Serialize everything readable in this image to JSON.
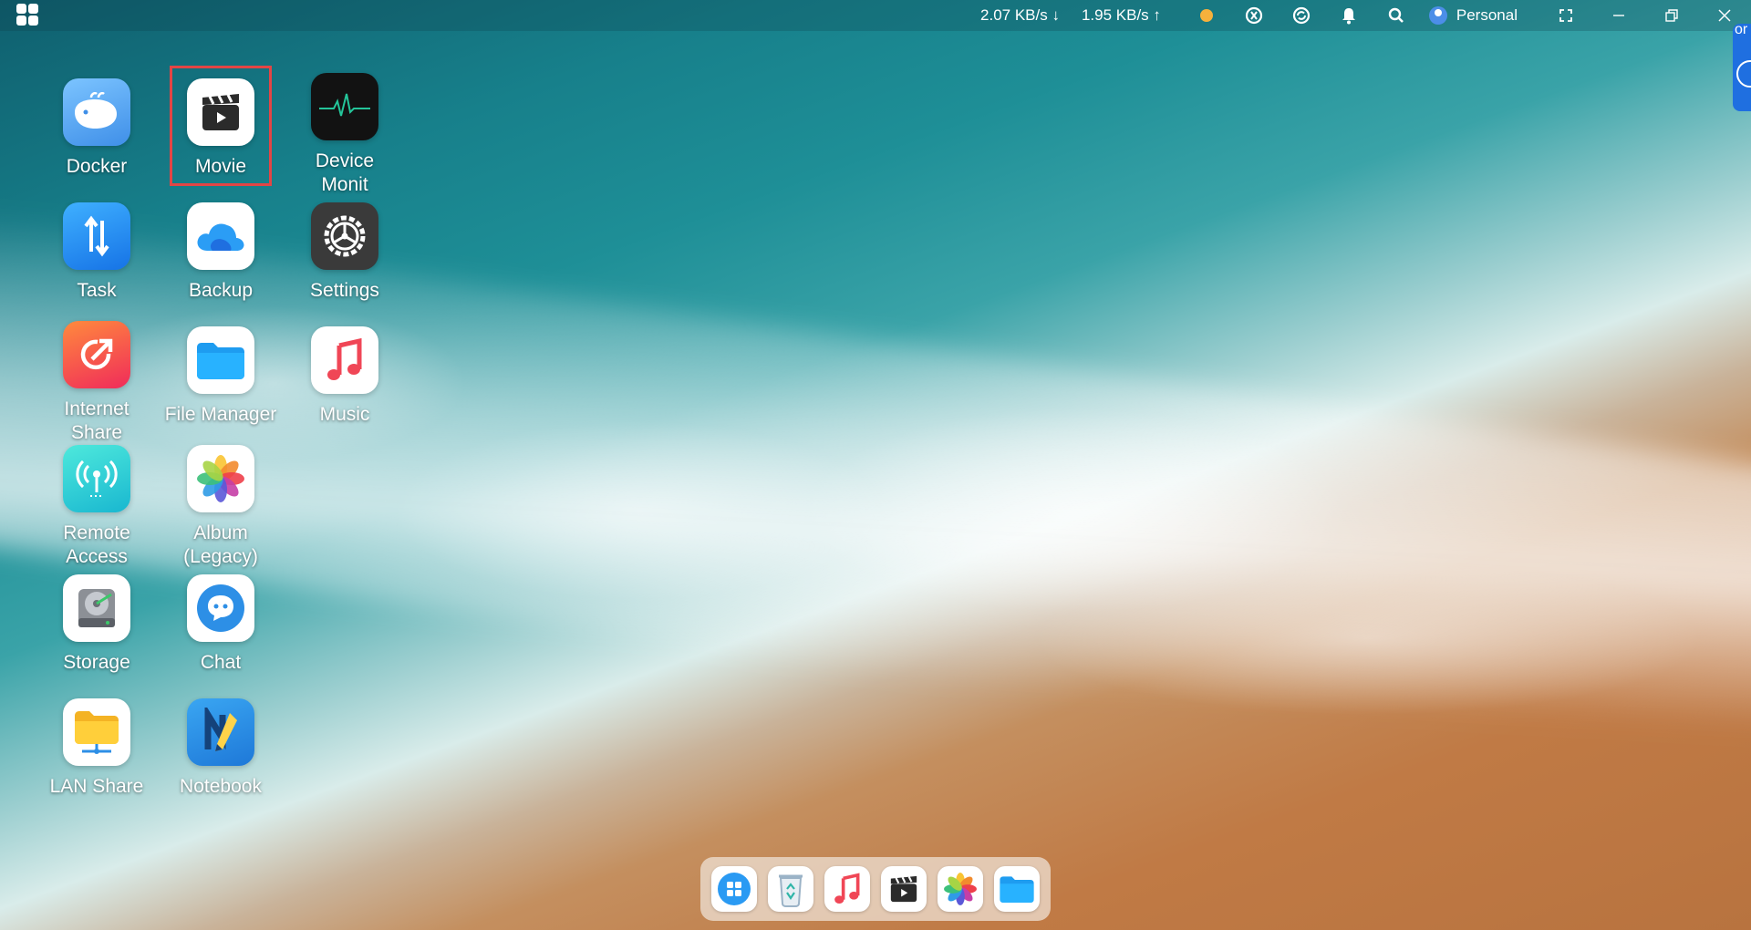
{
  "topbar": {
    "download_speed": "2.07 KB/s ↓",
    "upload_speed": "1.95 KB/s ↑",
    "user_label": "Personal"
  },
  "edge_widget": {
    "text": "or"
  },
  "apps": [
    {
      "label": "Docker",
      "icon": "whale-icon",
      "color": "#4aa3f0"
    },
    {
      "label": "Movie",
      "icon": "clapperboard-icon",
      "color": "#ffffff"
    },
    {
      "label": "Device\nMonit",
      "icon": "heartbeat-monitor-icon",
      "color": "#111111"
    },
    {
      "label": "Task",
      "icon": "transfer-arrows-icon",
      "color": "#1f8ff0"
    },
    {
      "label": "Backup",
      "icon": "cloud-icon",
      "color": "#ffffff"
    },
    {
      "label": "Settings",
      "icon": "gear-icon",
      "color": "#3b3b3b"
    },
    {
      "label": "Internet\nShare",
      "icon": "share-arrow-icon",
      "color": "#f04a3e"
    },
    {
      "label": "File Manager",
      "icon": "folder-icon",
      "color": "#ffffff"
    },
    {
      "label": "Music",
      "icon": "music-note-icon",
      "color": "#ffffff"
    },
    {
      "label": "Remote\nAccess",
      "icon": "antenna-icon",
      "color": "#2fd3d0"
    },
    {
      "label": "Album\n(Legacy)",
      "icon": "photos-flower-icon",
      "color": "#ffffff"
    },
    {
      "label": "Storage",
      "icon": "hard-drive-icon",
      "color": "#ffffff"
    },
    {
      "label": "Chat",
      "icon": "chat-bubble-icon",
      "color": "#ffffff"
    },
    {
      "label": "LAN Share",
      "icon": "lan-folder-icon",
      "color": "#ffffff"
    },
    {
      "label": "Notebook",
      "icon": "notebook-icon",
      "color": "#2d8fe6"
    }
  ],
  "dock": [
    {
      "name": "app-launcher-icon"
    },
    {
      "name": "recycle-bin-icon"
    },
    {
      "name": "music-note-icon"
    },
    {
      "name": "clapperboard-icon"
    },
    {
      "name": "photos-flower-icon"
    },
    {
      "name": "folder-icon"
    }
  ]
}
